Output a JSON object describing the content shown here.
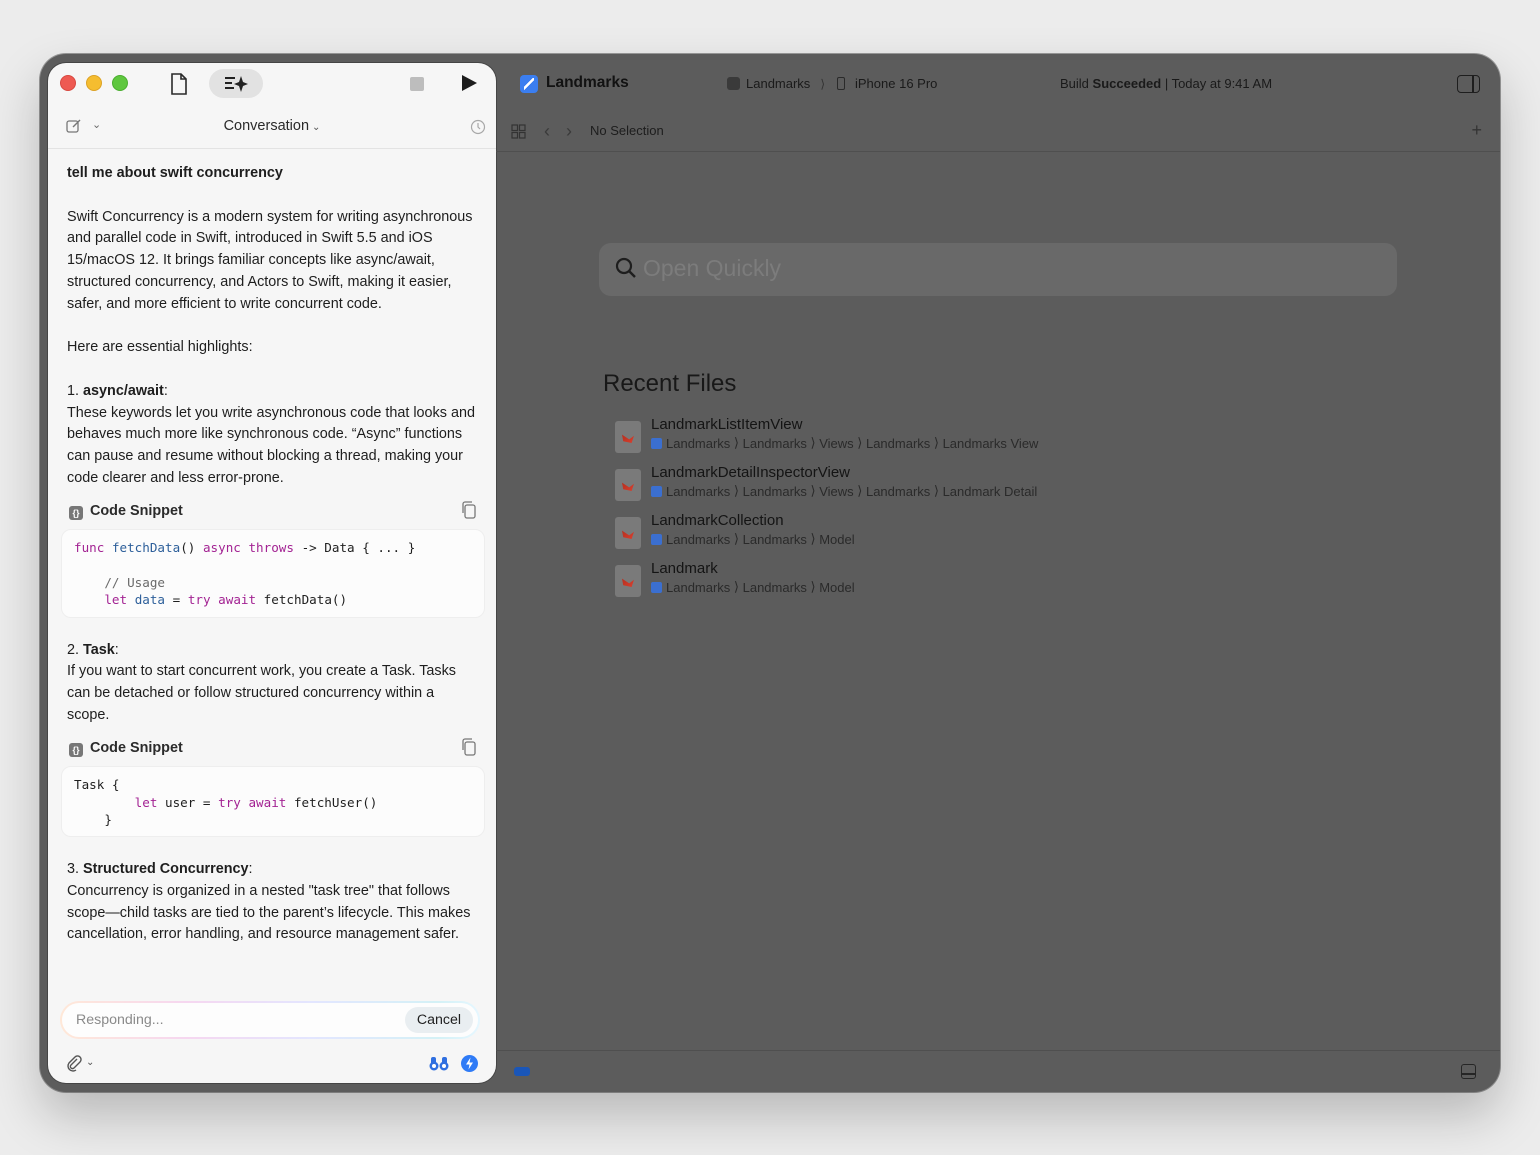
{
  "chat": {
    "toolbar": {
      "title": "Conversation"
    },
    "question": "tell me about swift concurrency",
    "intro": "Swift Concurrency is a modern system for writing asynchronous and parallel code in Swift, introduced in Swift 5.5 and iOS 15/macOS 12. It brings familiar concepts like async/await, structured concurrency, and Actors to Swift, making it easier, safer, and more efficient to write concurrent code.",
    "highlights": "Here are essential highlights:",
    "sections": [
      {
        "num": "1.",
        "title": "async/await",
        "body": "These keywords let you write asynchronous code that looks and behaves much more like synchronous code. “Async” functions can pause and resume without blocking a thread, making your code clearer and less error-prone.",
        "snippet_label": "Code Snippet"
      },
      {
        "num": "2.",
        "title": "Task",
        "body": "If you want to start concurrent work, you create a Task. Tasks can be detached or follow structured concurrency within a scope.",
        "snippet_label": "Code Snippet"
      },
      {
        "num": "3.",
        "title": "Structured Concurrency",
        "body": "Concurrency is organized in a nested \"task tree\" that follows scope—child tasks are tied to the parent’s lifecycle. This makes cancellation, error handling, and resource management safer."
      }
    ],
    "code1": {
      "l1_kw": "func",
      "l1_fn": "fetchData",
      "l1_a": "()",
      "l1_kw2": "async",
      "l1_kw3": "throws",
      "l1_rest": "-> Data { ... }",
      "l2_comment": "// Usage",
      "l3_kw": "let",
      "l3_var": "data",
      "l3_eq": "=",
      "l3_kw2": "try",
      "l3_kw3": "await",
      "l3_rest": "fetchData()"
    },
    "code2": {
      "l1": "Task {",
      "l2_kw": "let",
      "l2_a": "user =",
      "l2_kw2": "try",
      "l2_kw3": "await",
      "l2_rest": "fetchUser()",
      "l3": "}"
    },
    "input": {
      "status": "Responding...",
      "cancel_label": "Cancel"
    }
  },
  "xcode": {
    "project": "Landmarks",
    "scheme": "Landmarks",
    "device": "iPhone 16 Pro",
    "build_prefix": "Build",
    "build_status": "Succeeded",
    "build_time": "| Today at 9:41 AM",
    "nav_selection": "No Selection",
    "open_quickly_placeholder": "Open Quickly",
    "recent_title": "Recent Files",
    "recent_files": [
      {
        "name": "LandmarkListItemView",
        "path": [
          "Landmarks",
          "Landmarks",
          "Views",
          "Landmarks",
          "Landmarks View"
        ]
      },
      {
        "name": "LandmarkDetailInspectorView",
        "path": [
          "Landmarks",
          "Landmarks",
          "Views",
          "Landmarks",
          "Landmark Detail"
        ]
      },
      {
        "name": "LandmarkCollection",
        "path": [
          "Landmarks",
          "Landmarks",
          "Model"
        ]
      },
      {
        "name": "Landmark",
        "path": [
          "Landmarks",
          "Landmarks",
          "Model"
        ]
      }
    ]
  },
  "colors": {
    "keyword": "#a32393",
    "function": "#2d5f9a",
    "accent": "#2f7bf6",
    "editor_bg": "#5c5c5c"
  }
}
